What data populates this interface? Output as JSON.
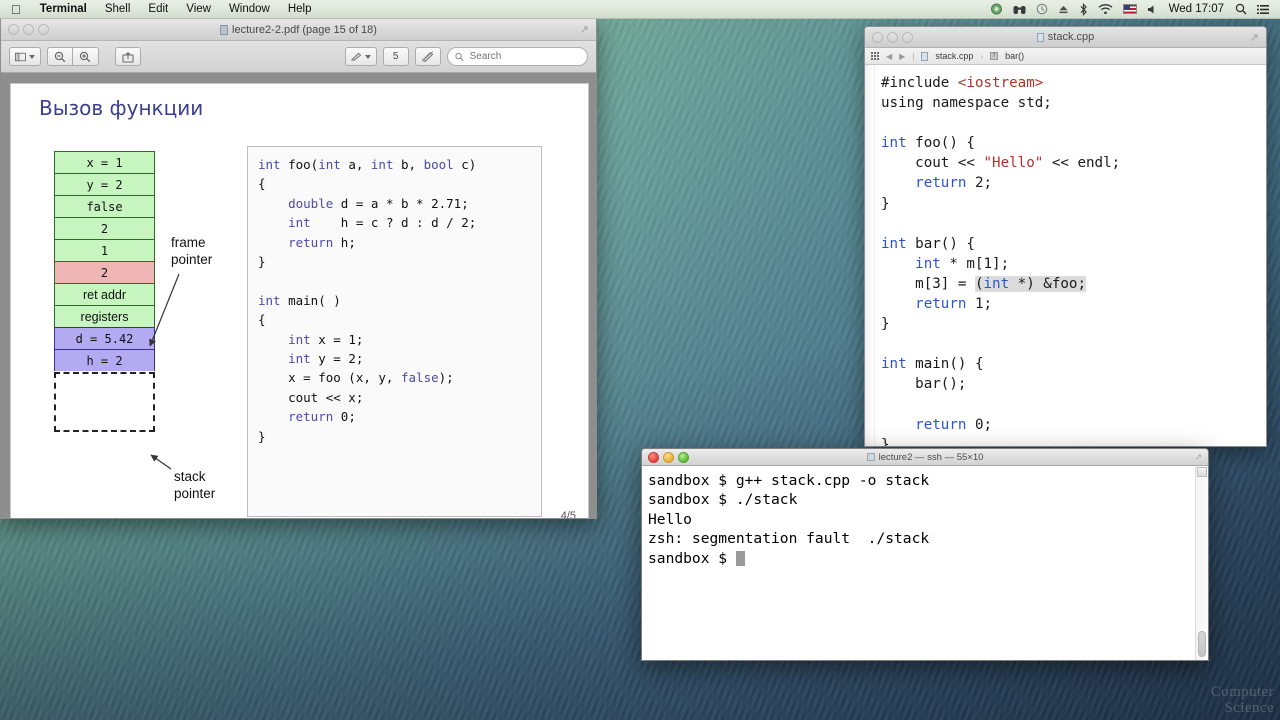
{
  "menubar": {
    "apple": "",
    "items": [
      {
        "label": "Terminal",
        "bold": true
      },
      {
        "label": "Shell",
        "bold": false
      },
      {
        "label": "Edit",
        "bold": false
      },
      {
        "label": "View",
        "bold": false
      },
      {
        "label": "Window",
        "bold": false
      },
      {
        "label": "Help",
        "bold": false
      }
    ],
    "status_icons": [
      "dropbox-icon",
      "binoculars-icon",
      "clock-icon",
      "eject-icon",
      "bluetooth-icon",
      "wifi-icon",
      "flag-icon",
      "volume-icon"
    ],
    "clock": "Wed 17:07",
    "spotlight_icon": "search-icon",
    "notification_icon": "list-icon"
  },
  "preview": {
    "title": "lecture2-2.pdf (page 15 of 18)",
    "toolbar": {
      "sidebar_label": "",
      "zoom_out_label": "−",
      "zoom_in_label": "+",
      "share_label": "",
      "markup_label": "",
      "rotate_label": "5",
      "annotate_label": "",
      "search_placeholder": "Search"
    },
    "slide": {
      "title": "Вызов функции",
      "page_indicator": "4/5",
      "frame_pointer_label": "frame\npointer",
      "stack_pointer_label": "stack\npointer",
      "stack_cells": [
        {
          "text": "x = 1",
          "color": "green",
          "mono": true
        },
        {
          "text": "y = 2",
          "color": "green",
          "mono": true
        },
        {
          "text": "false",
          "color": "green",
          "mono": true
        },
        {
          "text": "2",
          "color": "green",
          "mono": true
        },
        {
          "text": "1",
          "color": "green",
          "mono": true
        },
        {
          "text": "2",
          "color": "red",
          "mono": true
        },
        {
          "text": "ret addr",
          "color": "green",
          "mono": false
        },
        {
          "text": "registers",
          "color": "green",
          "mono": false
        },
        {
          "text": "d = 5.42",
          "color": "purple",
          "mono": true
        },
        {
          "text": "h = 2",
          "color": "purple",
          "mono": true
        }
      ],
      "code_lines": [
        [
          {
            "t": "int",
            "k": true
          },
          {
            "t": " foo(",
            "k": false
          },
          {
            "t": "int",
            "k": true
          },
          {
            "t": " a, ",
            "k": false
          },
          {
            "t": "int",
            "k": true
          },
          {
            "t": " b, ",
            "k": false
          },
          {
            "t": "bool",
            "k": true
          },
          {
            "t": " c)",
            "k": false
          }
        ],
        [
          {
            "t": "{",
            "k": false
          }
        ],
        [
          {
            "t": "    ",
            "k": false
          },
          {
            "t": "double",
            "k": true
          },
          {
            "t": " d = a * b * 2.71;",
            "k": false
          }
        ],
        [
          {
            "t": "    ",
            "k": false
          },
          {
            "t": "int",
            "k": true
          },
          {
            "t": "    h = c ? d : d / 2;",
            "k": false
          }
        ],
        [
          {
            "t": "    ",
            "k": false
          },
          {
            "t": "return",
            "k": true
          },
          {
            "t": " h;",
            "k": false
          }
        ],
        [
          {
            "t": "}",
            "k": false
          }
        ],
        [
          {
            "t": "",
            "k": false
          }
        ],
        [
          {
            "t": "int",
            "k": true
          },
          {
            "t": " main( )",
            "k": false
          }
        ],
        [
          {
            "t": "{",
            "k": false
          }
        ],
        [
          {
            "t": "    ",
            "k": false
          },
          {
            "t": "int",
            "k": true
          },
          {
            "t": " x = 1;",
            "k": false
          }
        ],
        [
          {
            "t": "    ",
            "k": false
          },
          {
            "t": "int",
            "k": true
          },
          {
            "t": " y = 2;",
            "k": false
          }
        ],
        [
          {
            "t": "    x = foo (x, y, ",
            "k": false
          },
          {
            "t": "false",
            "k": true
          },
          {
            "t": ");",
            "k": false
          }
        ],
        [
          {
            "t": "    cout << x;",
            "k": false
          }
        ],
        [
          {
            "t": "    ",
            "k": false
          },
          {
            "t": "return",
            "k": true
          },
          {
            "t": " 0;",
            "k": false
          }
        ],
        [
          {
            "t": "}",
            "k": false
          }
        ]
      ]
    }
  },
  "editor": {
    "title": "stack.cpp",
    "jumpbar": {
      "grid_label": "",
      "back_label": "◀",
      "forward_label": "▶",
      "file_label": "stack.cpp",
      "separator": "›",
      "symbol_label": "bar()"
    },
    "code_lines": [
      [
        {
          "t": "#include",
          "c": "pp"
        },
        {
          "t": " ",
          "c": ""
        },
        {
          "t": "<iostream>",
          "c": "inc"
        }
      ],
      [
        {
          "t": "using",
          "c": ""
        },
        {
          "t": " namespace std;",
          "c": ""
        }
      ],
      [
        {
          "t": "",
          "c": ""
        }
      ],
      [
        {
          "t": "int",
          "c": "kw"
        },
        {
          "t": " foo() {",
          "c": ""
        }
      ],
      [
        {
          "t": "    cout << ",
          "c": ""
        },
        {
          "t": "\"Hello\"",
          "c": "str"
        },
        {
          "t": " << endl;",
          "c": ""
        }
      ],
      [
        {
          "t": "    ",
          "c": ""
        },
        {
          "t": "return",
          "c": "kw"
        },
        {
          "t": " 2;",
          "c": ""
        }
      ],
      [
        {
          "t": "}",
          "c": ""
        }
      ],
      [
        {
          "t": "",
          "c": ""
        }
      ],
      [
        {
          "t": "int",
          "c": "kw"
        },
        {
          "t": " bar() {",
          "c": ""
        }
      ],
      [
        {
          "t": "    ",
          "c": ""
        },
        {
          "t": "int",
          "c": "kw"
        },
        {
          "t": " * m[1];",
          "c": ""
        }
      ],
      [
        {
          "t": "    m[3] = ",
          "c": ""
        },
        {
          "t": "(",
          "c": "sel"
        },
        {
          "t": "int",
          "c": "kw sel"
        },
        {
          "t": " *) &foo;",
          "c": "sel"
        }
      ],
      [
        {
          "t": "    ",
          "c": ""
        },
        {
          "t": "return",
          "c": "kw"
        },
        {
          "t": " 1;",
          "c": ""
        }
      ],
      [
        {
          "t": "}",
          "c": ""
        }
      ],
      [
        {
          "t": "",
          "c": ""
        }
      ],
      [
        {
          "t": "int",
          "c": "kw"
        },
        {
          "t": " main() {",
          "c": ""
        }
      ],
      [
        {
          "t": "    bar();",
          "c": ""
        }
      ],
      [
        {
          "t": "",
          "c": ""
        }
      ],
      [
        {
          "t": "    ",
          "c": ""
        },
        {
          "t": "return",
          "c": "kw"
        },
        {
          "t": " 0;",
          "c": ""
        }
      ],
      [
        {
          "t": "}",
          "c": ""
        }
      ]
    ]
  },
  "terminal": {
    "title": "lecture2 — ssh — 55×10",
    "lines": [
      "sandbox $ g++ stack.cpp -o stack",
      "sandbox $ ./stack",
      "Hello",
      "zsh: segmentation fault  ./stack",
      "sandbox $ "
    ],
    "prompt_cursor": true
  },
  "desktop": {
    "watermark": "Computer\nScience"
  }
}
